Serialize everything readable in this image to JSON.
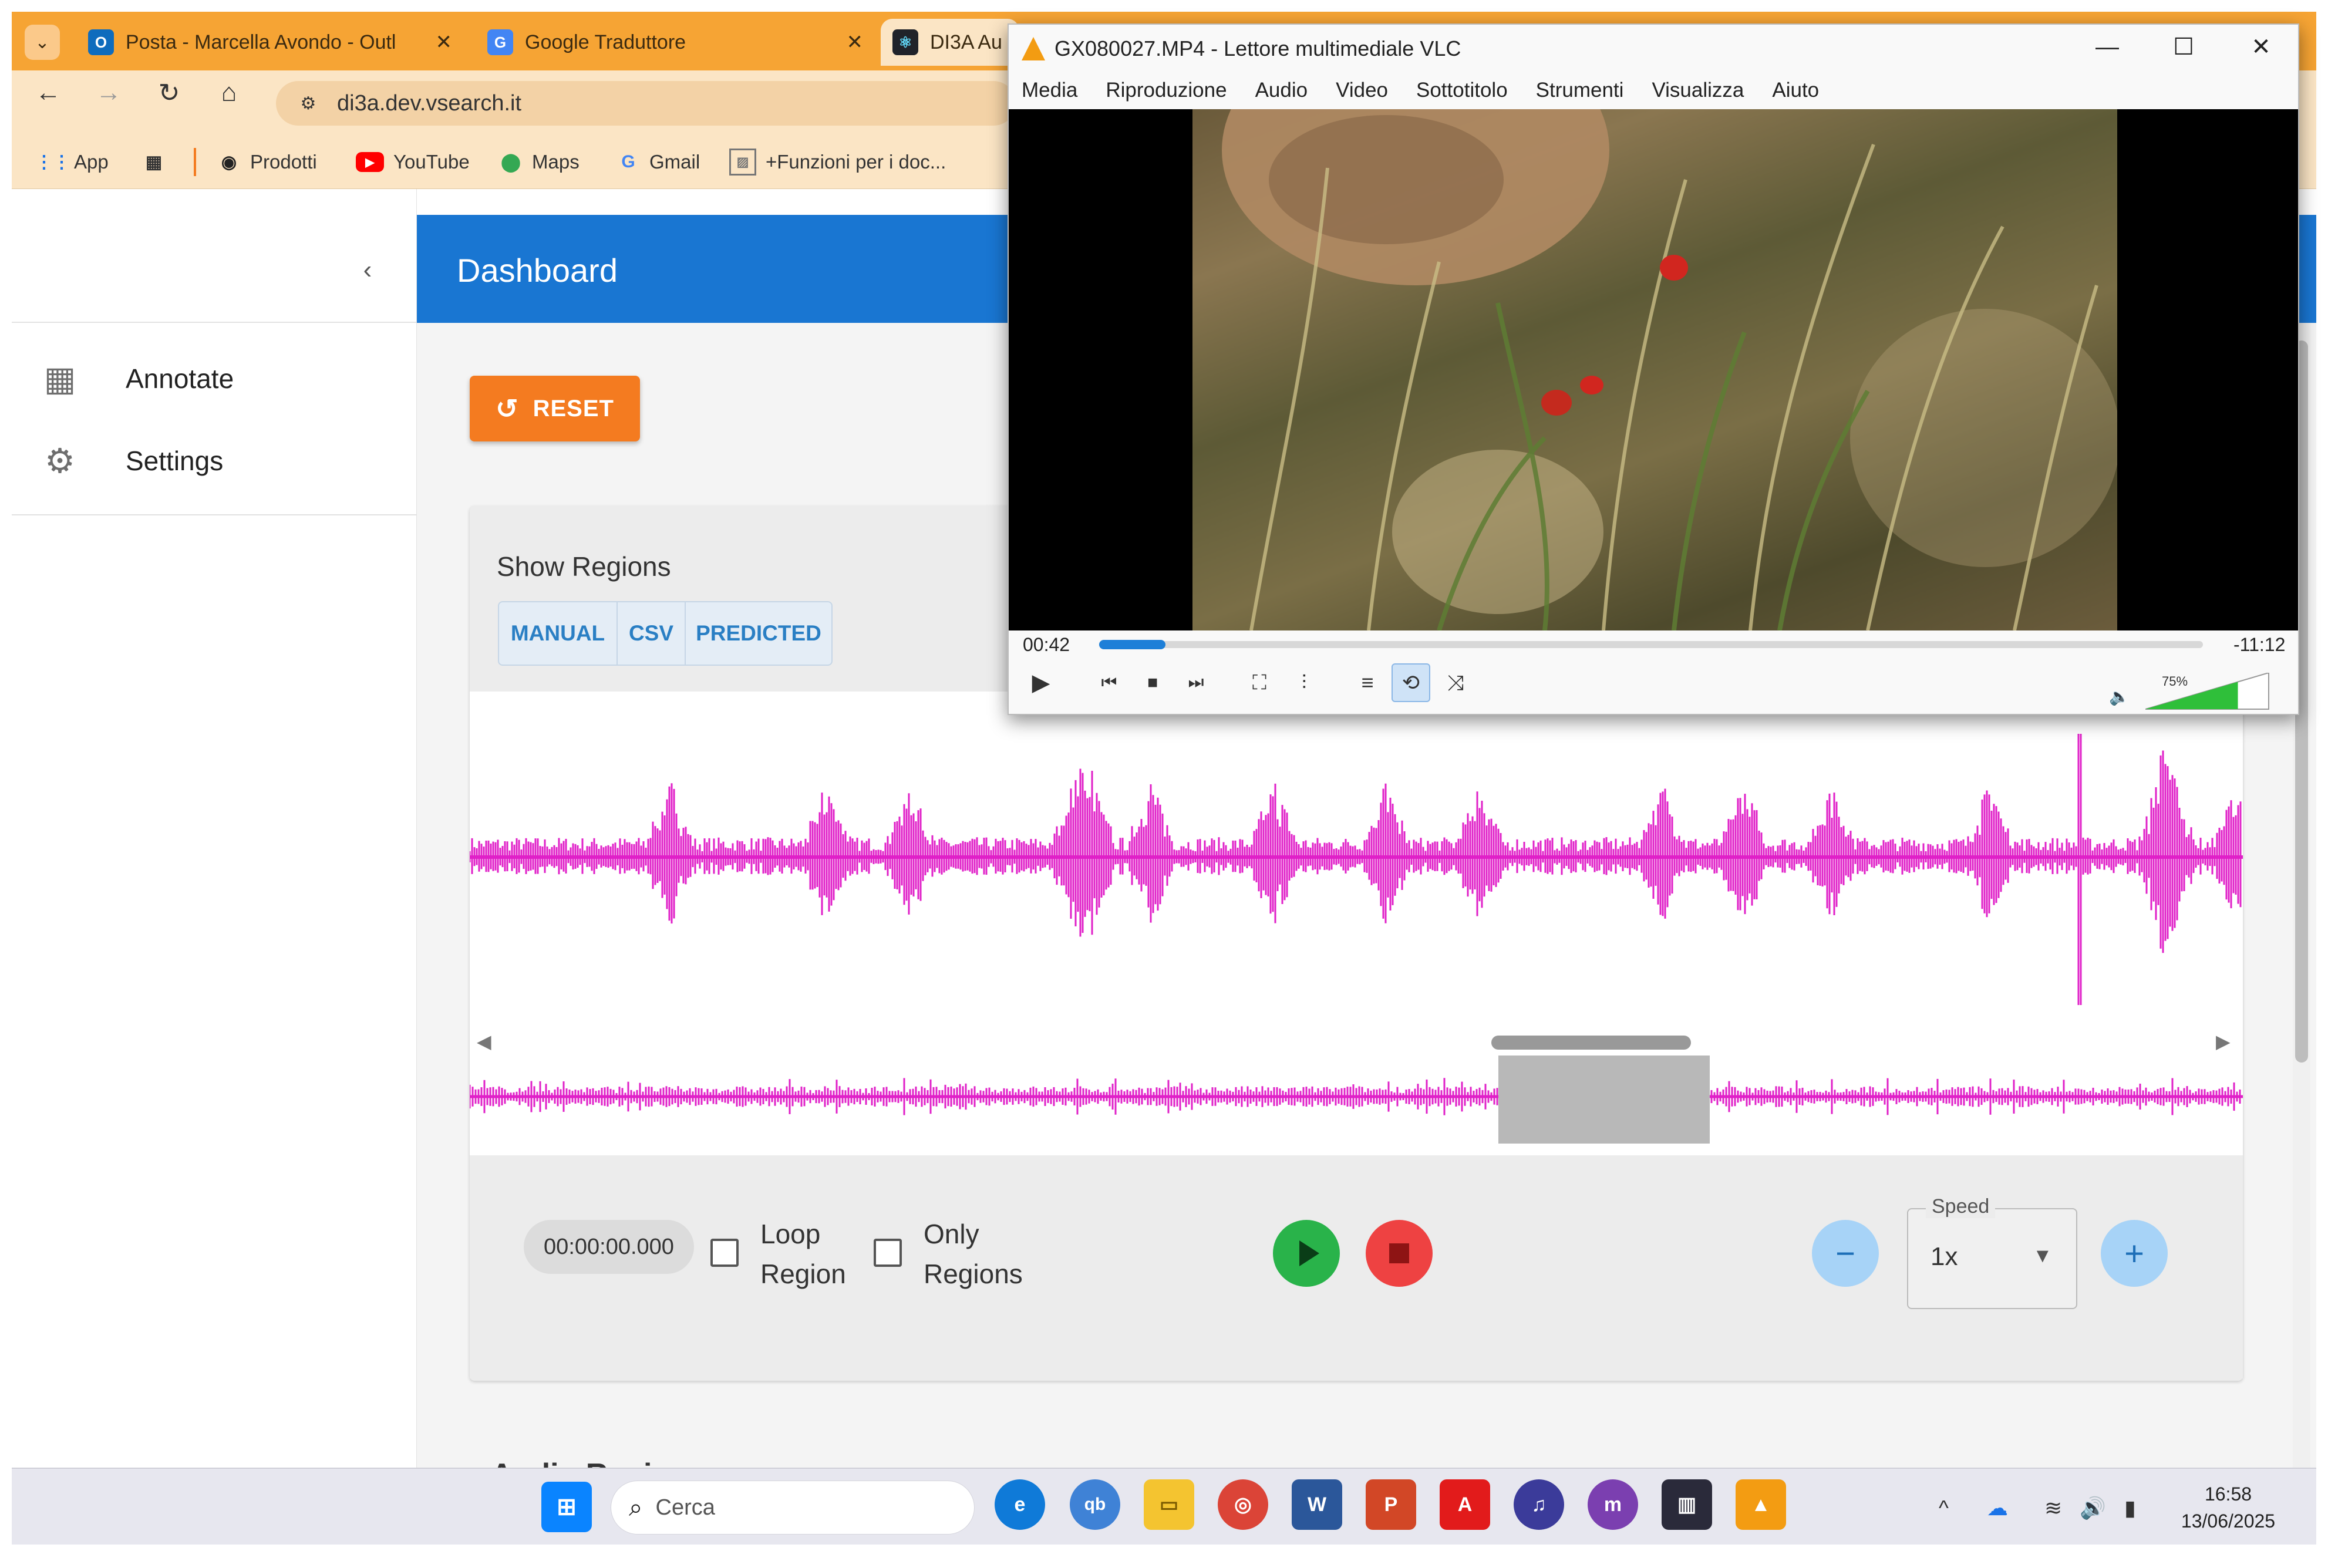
{
  "browser": {
    "tabs": [
      {
        "label": "Posta - Marcella Avondo - Outl",
        "icon": "outlook-icon",
        "color": "#0f6cbd"
      },
      {
        "label": "Google Traduttore",
        "icon": "translate-icon",
        "color": "#4285f4"
      },
      {
        "label": "DI3A Au",
        "icon": "react-icon",
        "color": "#20232a"
      }
    ],
    "url": "di3a.dev.vsearch.it",
    "bookmarks": [
      {
        "label": "App",
        "icon": "apps-grid-icon"
      },
      {
        "label": "Prodotti",
        "icon": "globe-icon"
      },
      {
        "label": "YouTube",
        "icon": "youtube-icon"
      },
      {
        "label": "Maps",
        "icon": "maps-pin-icon"
      },
      {
        "label": "Gmail",
        "icon": "google-g-icon"
      },
      {
        "label": "+Funzioni per i doc...",
        "icon": "image-doc-icon"
      }
    ]
  },
  "app": {
    "title": "Dashboard",
    "nav": [
      {
        "label": "Annotate",
        "icon": "dashboard-icon"
      },
      {
        "label": "Settings",
        "icon": "gear-icon"
      }
    ],
    "reset_label": "RESET",
    "show_regions_title": "Show Regions",
    "region_buttons": [
      "MANUAL",
      "CSV",
      "PREDICTED"
    ],
    "time_display": "00:00:00.000",
    "loop_region": [
      "Loop",
      "Region"
    ],
    "only_regions": [
      "Only",
      "Regions"
    ],
    "speed_label": "Speed",
    "speed_value": "1x",
    "partial_heading": "Audio Regions",
    "waveform_color": "#e020c8"
  },
  "vlc": {
    "title": "GX080027.MP4 - Lettore multimediale VLC",
    "menu": [
      "Media",
      "Riproduzione",
      "Audio",
      "Video",
      "Sottotitolo",
      "Strumenti",
      "Visualizza",
      "Aiuto"
    ],
    "elapsed": "00:42",
    "remaining": "-11:12",
    "volume": "75%",
    "progress_fraction": 0.06
  },
  "taskbar": {
    "search_placeholder": "Cerca",
    "time": "16:58",
    "date": "13/06/2025"
  }
}
